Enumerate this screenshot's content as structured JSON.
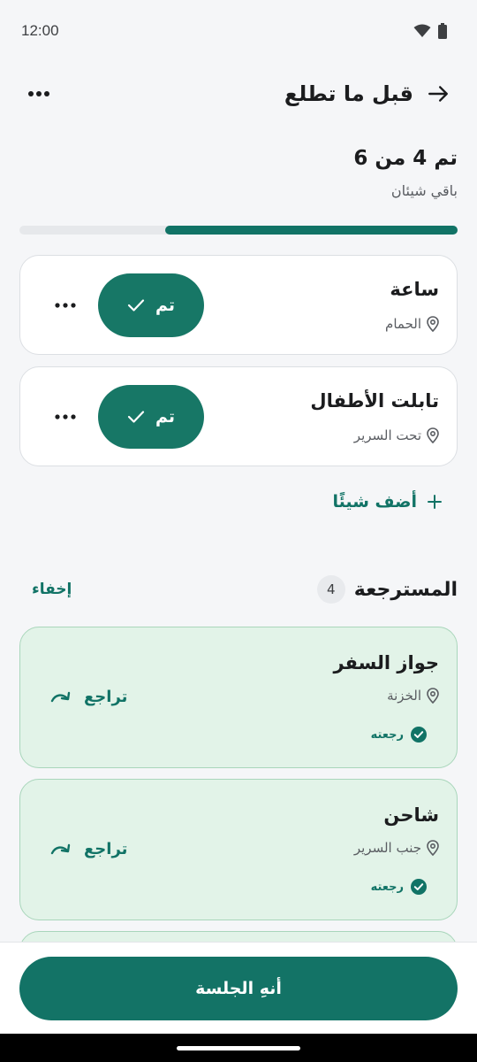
{
  "status_bar": {
    "time": "12:00"
  },
  "header": {
    "title": "قبل ما تطلع"
  },
  "progress": {
    "title": "تم 4 من 6",
    "subtitle": "باقي شيئان",
    "fraction": 0.667
  },
  "items": [
    {
      "name": "ساعة",
      "location": "الحمام",
      "done_label": "تم"
    },
    {
      "name": "تابلت الأطفال",
      "location": "تحت السرير",
      "done_label": "تم"
    }
  ],
  "add_label": "أضف شيئًا",
  "returned": {
    "title": "المسترجعة",
    "count": "4",
    "hide_label": "إخفاء",
    "items": [
      {
        "name": "جواز السفر",
        "location": "الخزنة",
        "status": "رجعته",
        "undo_label": "تراجع"
      },
      {
        "name": "شاحن",
        "location": "جنب السرير",
        "status": "رجعته",
        "undo_label": "تراجع"
      }
    ]
  },
  "footer": {
    "end_session_label": "أنهِ الجلسة"
  },
  "colors": {
    "primary": "#177766",
    "returned_bg": "#e2f3e8",
    "returned_border": "#a9d6bb",
    "background": "#f5f6f8"
  }
}
